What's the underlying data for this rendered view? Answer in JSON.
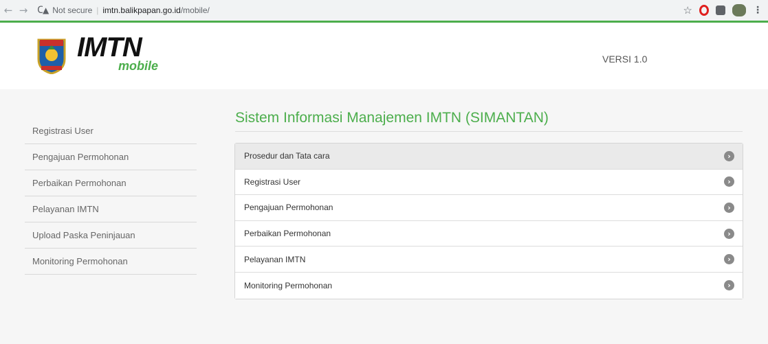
{
  "browser": {
    "security_label": "Not secure",
    "url_host": "imtn.balikpapan.go.id",
    "url_path": "/mobile/"
  },
  "header": {
    "logo_text": "IMTN",
    "logo_sub": "mobile",
    "version": "VERSI 1.0"
  },
  "sidebar": {
    "items": [
      {
        "label": "Registrasi User"
      },
      {
        "label": "Pengajuan Permohonan"
      },
      {
        "label": "Perbaikan Permohonan"
      },
      {
        "label": "Pelayanan IMTN"
      },
      {
        "label": "Upload Paska Peninjauan"
      },
      {
        "label": "Monitoring Permohonan"
      }
    ]
  },
  "main": {
    "title": "Sistem Informasi Manajemen IMTN (SIMANTAN)",
    "items": [
      {
        "label": "Prosedur dan Tata cara"
      },
      {
        "label": "Registrasi User"
      },
      {
        "label": "Pengajuan Permohonan"
      },
      {
        "label": "Perbaikan Permohonan"
      },
      {
        "label": "Pelayanan IMTN"
      },
      {
        "label": "Monitoring Permohonan"
      }
    ]
  },
  "colors": {
    "accent": "#4cae4c",
    "chevron": "#8a8a8a"
  }
}
